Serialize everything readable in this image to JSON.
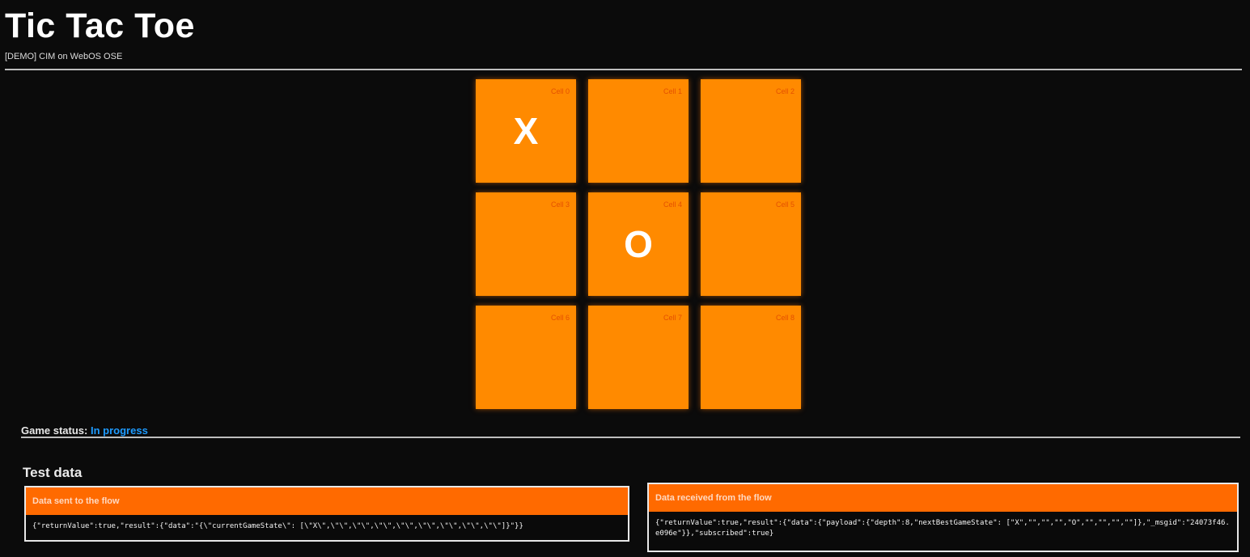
{
  "app": {
    "title": "Tic Tac Toe",
    "subtitle": "[DEMO] CIM on WebOS OSE"
  },
  "board": {
    "cells": [
      {
        "label": "Cell 0",
        "mark": "X"
      },
      {
        "label": "Cell 1",
        "mark": ""
      },
      {
        "label": "Cell 2",
        "mark": ""
      },
      {
        "label": "Cell 3",
        "mark": ""
      },
      {
        "label": "Cell 4",
        "mark": "O"
      },
      {
        "label": "Cell 5",
        "mark": ""
      },
      {
        "label": "Cell 6",
        "mark": ""
      },
      {
        "label": "Cell 7",
        "mark": ""
      },
      {
        "label": "Cell 8",
        "mark": ""
      }
    ],
    "colors": {
      "cell": "#ff8a00",
      "mark": "#ffffff"
    }
  },
  "status": {
    "label": "Game status:",
    "value": "In progress",
    "value_color": "#1e9bff"
  },
  "test_data": {
    "title": "Test data",
    "sent": {
      "header": "Data sent to the flow",
      "body": "{\"returnValue\":true,\"result\":{\"data\":\"{\\\"currentGameState\\\": [\\\"X\\\",\\\"\\\",\\\"\\\",\\\"\\\",\\\"\\\",\\\"\\\",\\\"\\\",\\\"\\\",\\\"\\\"]}\"}}"
    },
    "received": {
      "header": "Data received from the flow",
      "body": "{\"returnValue\":true,\"result\":{\"data\":{\"payload\":{\"depth\":8,\"nextBestGameState\": [\"X\",\"\",\"\",\"\",\"O\",\"\",\"\",\"\",\"\"]},\"_msgid\":\"24073f46.e096e\"}},\"subscribed\":true}"
    }
  }
}
